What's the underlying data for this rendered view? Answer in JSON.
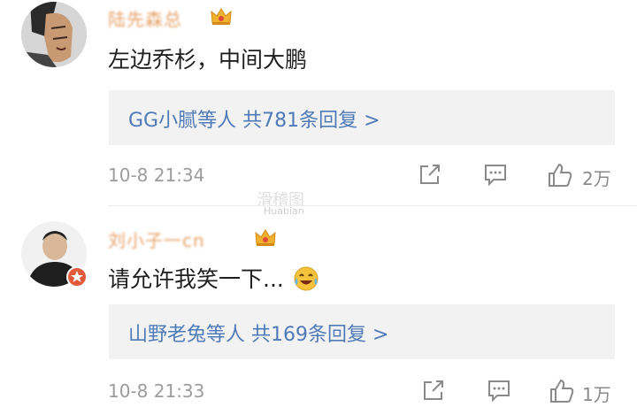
{
  "comments": [
    {
      "username": "陆先森总",
      "text": "左边乔杉，中间大鹏",
      "replies_summary": "GG小腻等人  共781条回复 >",
      "time": "10-8 21:34",
      "likes": "2万"
    },
    {
      "username": "刘小子一cn",
      "text": "请允许我笑一下...",
      "replies_summary": "山野老兔等人  共169条回复 >",
      "time": "10-8 21:33",
      "likes": "1万"
    }
  ],
  "watermark": "滑稽图",
  "watermark_sub": "Huabian",
  "colors": {
    "username": "#e7a36a",
    "link": "#4f7ab8",
    "meta": "#9c9c9c",
    "badge": "#e15b3a",
    "crown": "#f0b030"
  }
}
